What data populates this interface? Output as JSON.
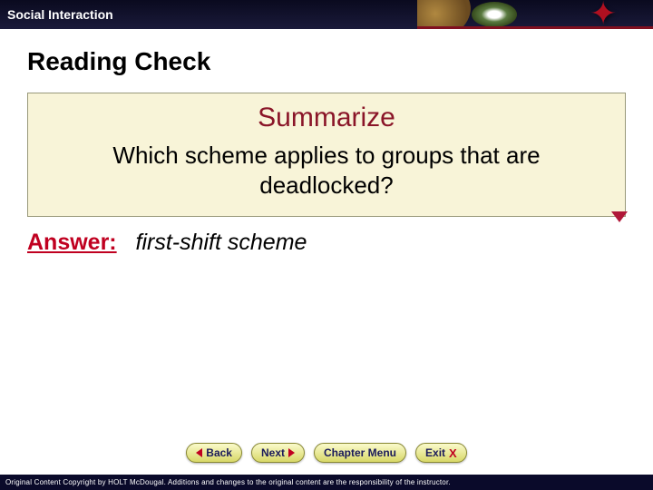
{
  "header": {
    "title": "Social Interaction"
  },
  "content": {
    "section_title": "Reading Check",
    "summarize": {
      "title": "Summarize",
      "question": "Which scheme applies to groups that are deadlocked?"
    },
    "answer": {
      "label": "Answer:",
      "value": "first-shift scheme"
    }
  },
  "nav": {
    "back": "Back",
    "next": "Next",
    "chapter_menu": "Chapter Menu",
    "exit": "Exit"
  },
  "footer": {
    "copyright": "Original Content Copyright by HOLT McDougal. Additions and changes to the original content are the responsibility of the instructor."
  }
}
